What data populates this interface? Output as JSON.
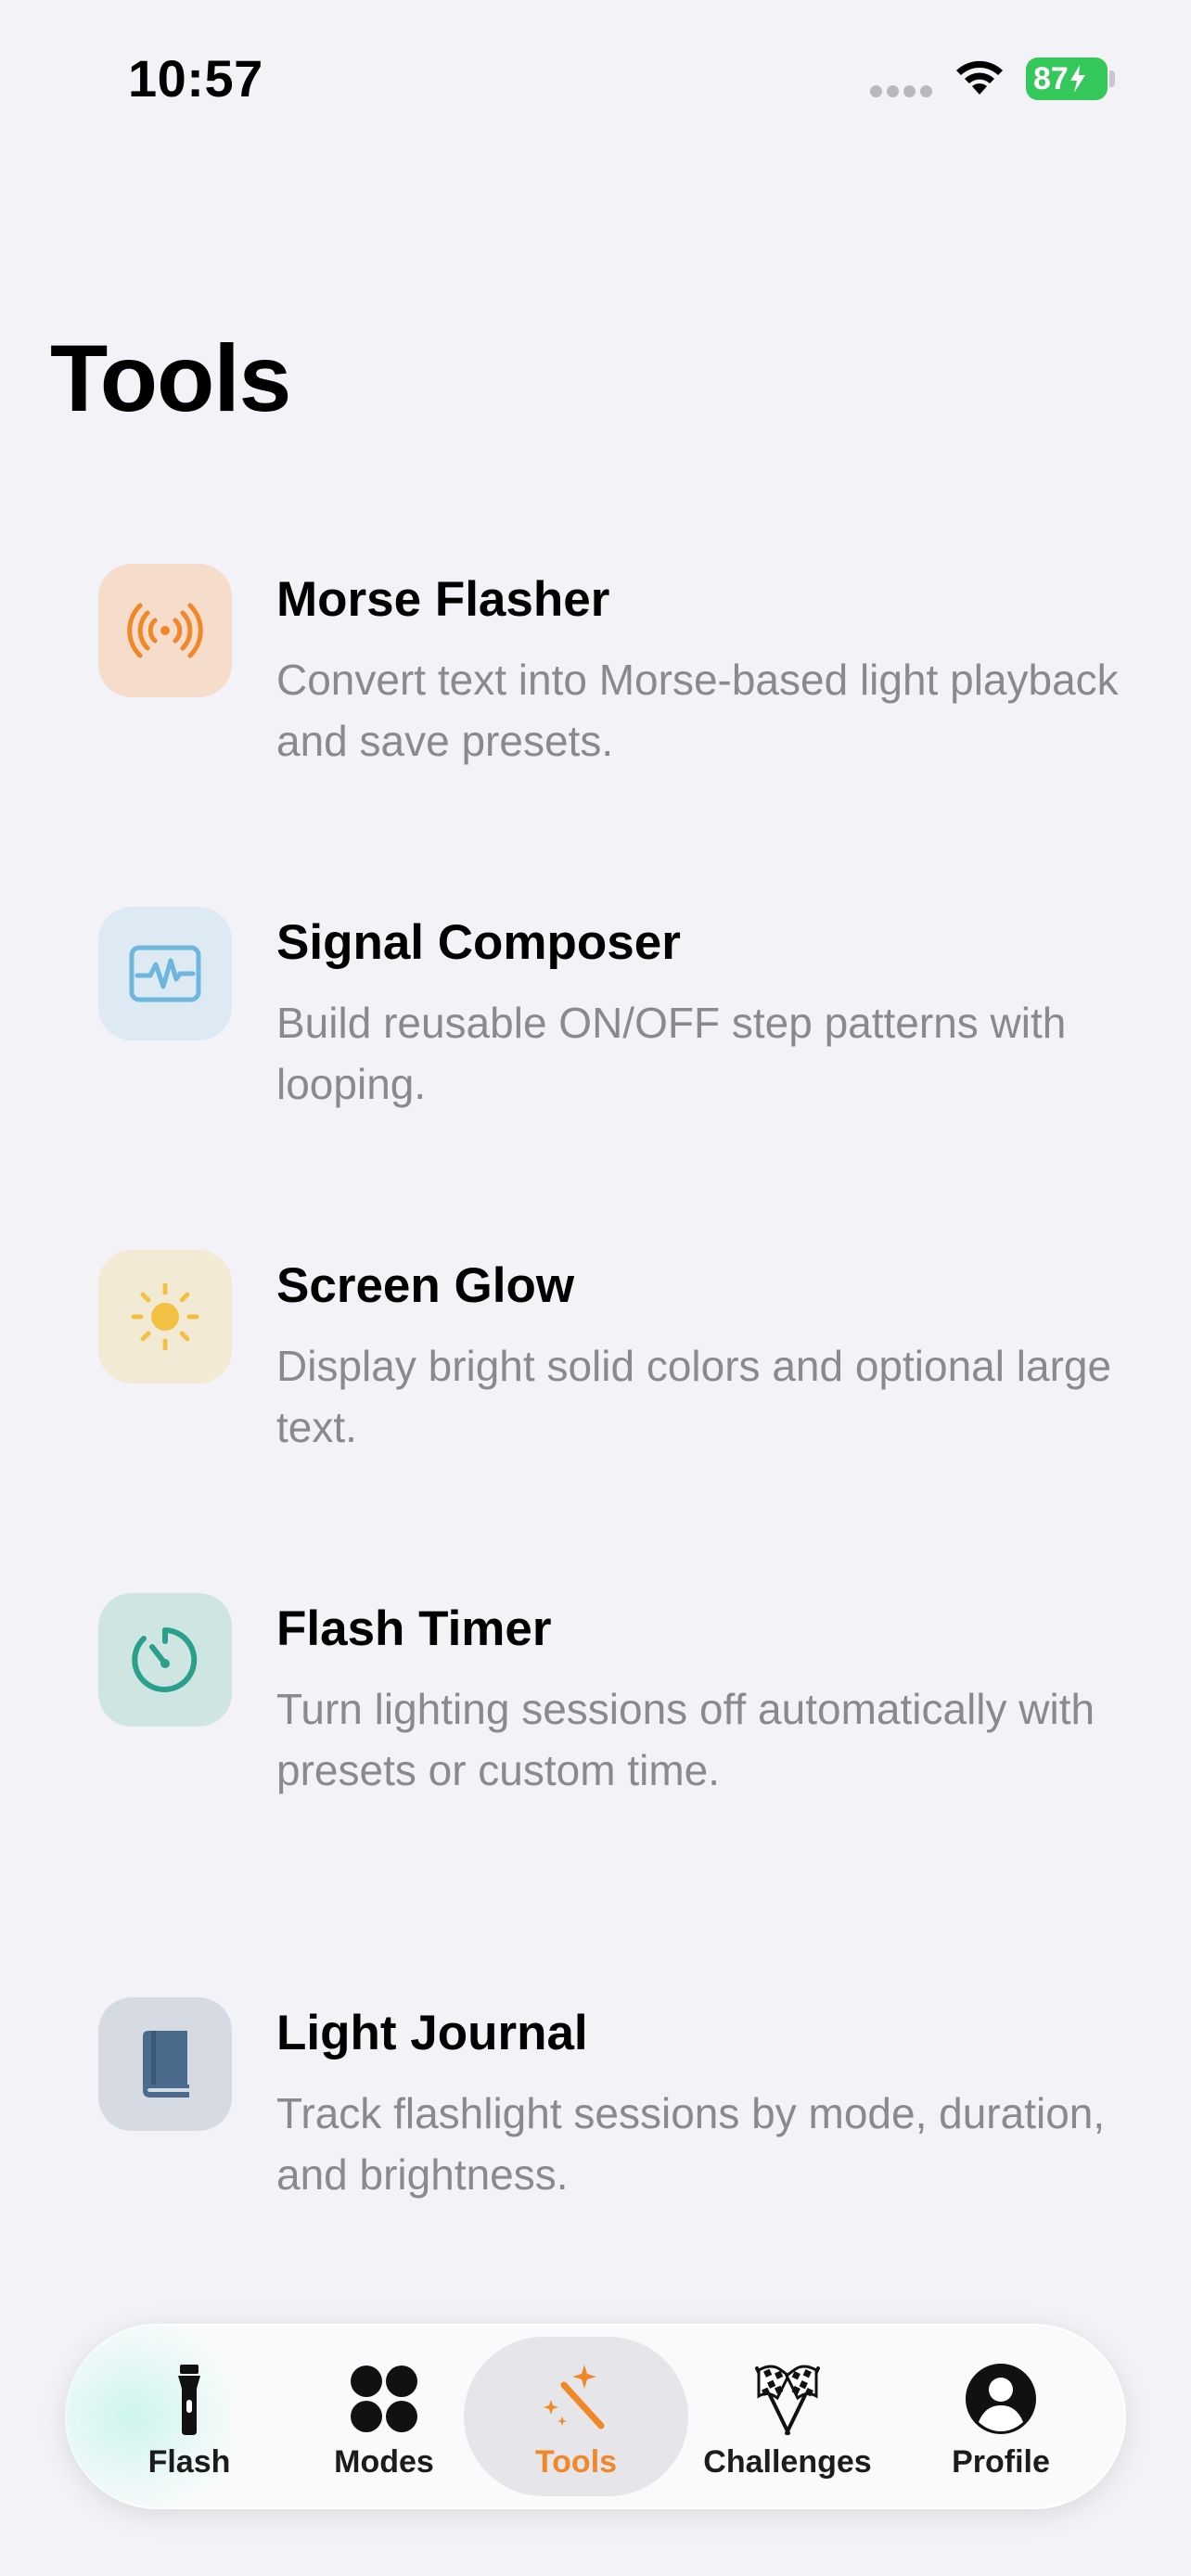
{
  "status_bar": {
    "time": "10:57",
    "battery_level": "87"
  },
  "page": {
    "title": "Tools"
  },
  "tools": [
    {
      "title": "Morse Flasher",
      "description": "Convert text into Morse-based light playback and save presets.",
      "icon": "broadcast-icon",
      "icon_color": "#f0882a",
      "icon_bg": "#f5dccb"
    },
    {
      "title": "Signal Composer",
      "description": "Build reusable ON/OFF step patterns with looping.",
      "icon": "waveform-icon",
      "icon_color": "#6fb6de",
      "icon_bg": "#dde9f3"
    },
    {
      "title": "Screen Glow",
      "description": "Display bright solid colors and optional large text.",
      "icon": "sun-icon",
      "icon_color": "#f2c144",
      "icon_bg": "#f3ead6"
    },
    {
      "title": "Flash Timer",
      "description": "Turn lighting sessions off automatically with presets or custom time.",
      "icon": "timer-icon",
      "icon_color": "#2aa08c",
      "icon_bg": "#cfe5e1"
    },
    {
      "title": "Light Journal",
      "description": "Track flashlight sessions by mode, duration, and brightness.",
      "icon": "book-icon",
      "icon_color": "#4a6b8c",
      "icon_bg": "#d6dbe3"
    }
  ],
  "tabbar": {
    "accent_color": "#f0882a",
    "tabs": [
      {
        "label": "Flash",
        "icon": "flashlight-icon",
        "active": false
      },
      {
        "label": "Modes",
        "icon": "four-dots-icon",
        "active": false
      },
      {
        "label": "Tools",
        "icon": "magic-wand-icon",
        "active": true
      },
      {
        "label": "Challenges",
        "icon": "checkered-flags-icon",
        "active": false
      },
      {
        "label": "Profile",
        "icon": "person-circle-icon",
        "active": false
      }
    ]
  }
}
